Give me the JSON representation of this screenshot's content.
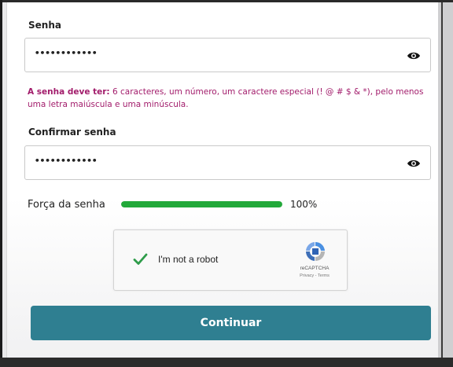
{
  "form": {
    "password_label": "Senha",
    "password_value": "••••••••••••",
    "confirm_label": "Confirmar senha",
    "confirm_value": "••••••••••••",
    "hint_prefix": "A senha deve ter:",
    "hint_text": " 6 caracteres, um número, um caractere especial (! @ # $ & *), pelo menos uma letra maiúscula e uma minúscula.",
    "continue_label": "Continuar"
  },
  "strength": {
    "label": "Força da senha",
    "value_text": "100%",
    "value": 1.0
  },
  "recaptcha": {
    "label": "I'm not a robot",
    "brand": "reCAPTCHA",
    "links": "Privacy - Terms",
    "checked": true
  },
  "colors": {
    "accent": "#2f7f91",
    "hint": "#a21c6b",
    "strength_fill": "#22a93a",
    "check": "#2e9c4a"
  },
  "icons": {
    "password_toggle": "eye-icon",
    "confirm_toggle": "eye-icon",
    "recaptcha_check": "checkmark-icon",
    "recaptcha_logo": "recaptcha-logo-icon"
  }
}
